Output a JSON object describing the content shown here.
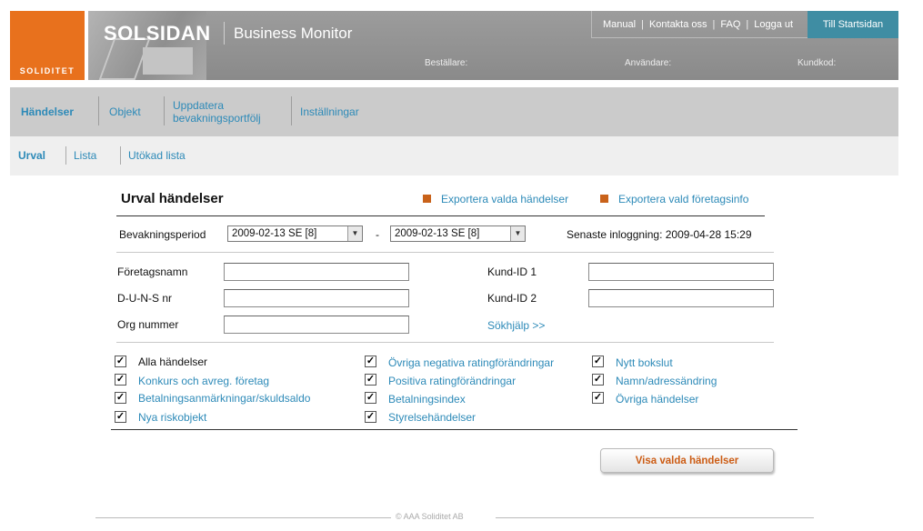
{
  "header": {
    "logo_text": "SOLIDITET",
    "brand": "SOLSIDAN",
    "product": "Business Monitor",
    "toplinks": [
      "Manual",
      "Kontakta oss",
      "FAQ",
      "Logga ut"
    ],
    "start_button": "Till Startsidan",
    "info": {
      "orderer_label": "Beställare:",
      "user_label": "Användare:",
      "customer_code_label": "Kundkod:"
    }
  },
  "mainnav": {
    "items": [
      "Händelser",
      "Objekt",
      "Uppdatera bevakningsportfölj",
      "Inställningar"
    ],
    "active": "Händelser"
  },
  "subnav": {
    "items": [
      "Urval",
      "Lista",
      "Utökad lista"
    ],
    "active": "Urval"
  },
  "content": {
    "title": "Urval händelser",
    "export_events": "Exportera valda händelser",
    "export_company": "Exportera vald företagsinfo",
    "period_label": "Bevakningsperiod",
    "period_from": "2009-02-13 SE [8]",
    "period_dash": "-",
    "period_to": "2009-02-13 SE [8]",
    "last_login": "Senaste inloggning: 2009-04-28 15:29",
    "fields": {
      "company_name": {
        "label": "Företagsnamn",
        "value": ""
      },
      "duns": {
        "label": "D-U-N-S nr",
        "value": ""
      },
      "org_number": {
        "label": "Org nummer",
        "value": ""
      },
      "customer_id_1": {
        "label": "Kund-ID 1",
        "value": ""
      },
      "customer_id_2": {
        "label": "Kund-ID 2",
        "value": ""
      }
    },
    "search_help": "Sökhjälp >>",
    "checkboxes": [
      {
        "label": "Alla händelser",
        "checked": true
      },
      {
        "label": "Konkurs och avreg. företag",
        "checked": true
      },
      {
        "label": "Betalningsanmärkningar/skuldsaldo",
        "checked": true
      },
      {
        "label": "Nya riskobjekt",
        "checked": true
      },
      {
        "label": "Övriga negativa ratingförändringar",
        "checked": true
      },
      {
        "label": "Positiva ratingförändringar",
        "checked": true
      },
      {
        "label": "Betalningsindex",
        "checked": true
      },
      {
        "label": "Styrelsehändelser",
        "checked": true
      },
      {
        "label": "Nytt bokslut",
        "checked": true
      },
      {
        "label": "Namn/adressändring",
        "checked": true
      },
      {
        "label": "Övriga händelser",
        "checked": true
      }
    ],
    "submit_button": "Visa valda händelser"
  },
  "footer": {
    "copyright": "© AAA Soliditet AB"
  },
  "colors": {
    "accent": "#e8711d",
    "link": "#2d8ab8",
    "start_button": "#3f8da3"
  }
}
